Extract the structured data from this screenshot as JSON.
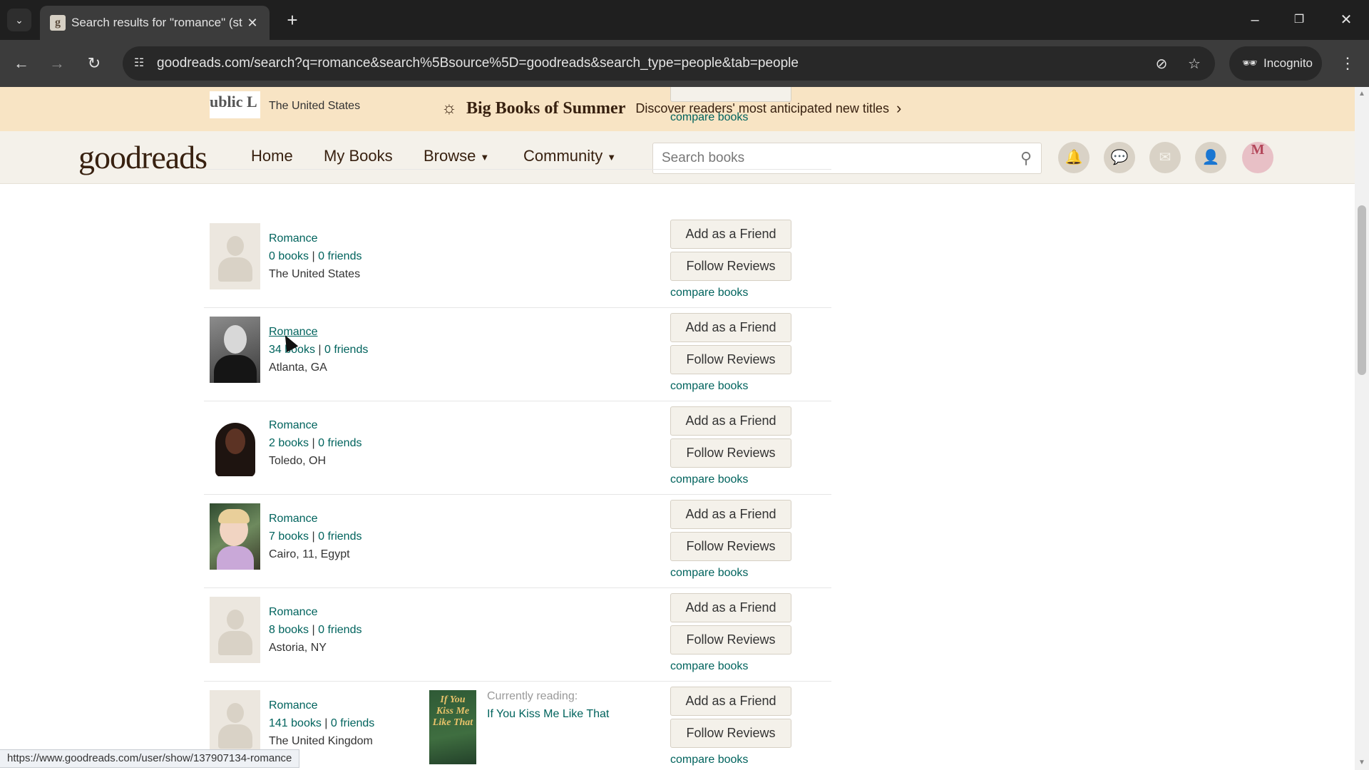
{
  "browser": {
    "tab_title": "Search results for \"romance\" (st",
    "url": "goodreads.com/search?q=romance&search%5Bsource%5D=goodreads&search_type=people&tab=people",
    "incognito_label": "Incognito",
    "status_url": "https://www.goodreads.com/user/show/137907134-romance"
  },
  "banner": {
    "title": "Big Books of Summer",
    "text": "Discover readers' most anticipated new titles"
  },
  "header": {
    "logo": "goodreads",
    "nav": [
      "Home",
      "My Books",
      "Browse",
      "Community"
    ],
    "search_placeholder": "Search books",
    "avatar_letter": "M"
  },
  "labels": {
    "add_friend": "Add as a Friend",
    "follow_reviews": "Follow Reviews",
    "compare_books": "compare books",
    "currently_reading": "Currently reading:"
  },
  "top_partial": {
    "location": "The United States",
    "pic_text": "ublic L"
  },
  "results": [
    {
      "name": "Romance",
      "books": "0 books",
      "friends": "0 friends",
      "location": "The United States"
    },
    {
      "name": "Romance",
      "books": "34 books",
      "friends": "0 friends",
      "location": "Atlanta, GA"
    },
    {
      "name": "Romance",
      "books": "2 books",
      "friends": "0 friends",
      "location": "Toledo, OH"
    },
    {
      "name": "Romance",
      "books": "7 books",
      "friends": "0 friends",
      "location": "Cairo, 11, Egypt"
    },
    {
      "name": "Romance",
      "books": "8 books",
      "friends": "0 friends",
      "location": "Astoria, NY"
    },
    {
      "name": "Romance",
      "books": "141 books",
      "friends": "0 friends",
      "location": "The United Kingdom",
      "currently_reading": "If You Kiss Me Like That",
      "cover_text": "If You Kiss Me Like That"
    }
  ],
  "colors": {
    "link": "#00635d",
    "banner_bg": "#f8e4c4",
    "header_bg": "#f4f1ea",
    "brand_text": "#382110"
  }
}
